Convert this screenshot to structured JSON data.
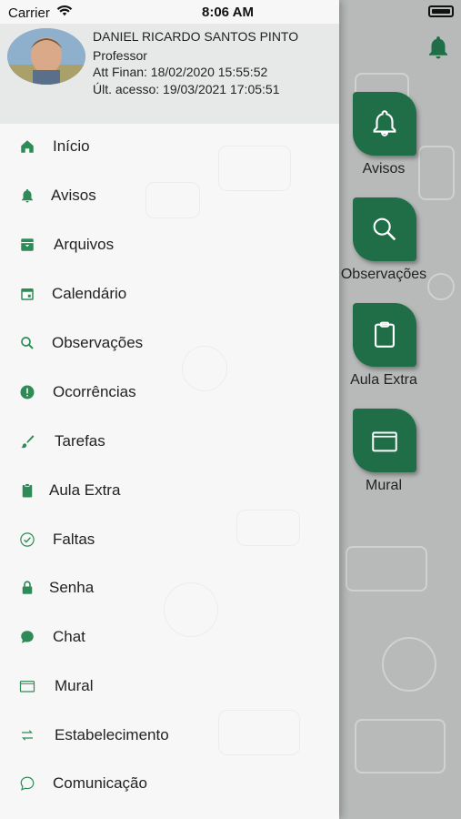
{
  "status": {
    "carrier": "Carrier",
    "time": "8:06 AM"
  },
  "user": {
    "name": "DANIEL RICARDO SANTOS PINTO",
    "role": "Professor",
    "att_finan": "Att Finan: 18/02/2020 15:55:52",
    "last_access": "Últ. acesso: 19/03/2021 17:05:51"
  },
  "menu": [
    {
      "label": "Início",
      "icon": "home-icon"
    },
    {
      "label": "Avisos",
      "icon": "bell-icon"
    },
    {
      "label": "Arquivos",
      "icon": "archive-icon"
    },
    {
      "label": "Calendário",
      "icon": "calendar-icon"
    },
    {
      "label": "Observações",
      "icon": "search-icon"
    },
    {
      "label": "Ocorrências",
      "icon": "alert-icon"
    },
    {
      "label": "Tarefas",
      "icon": "brush-icon"
    },
    {
      "label": "Aula Extra",
      "icon": "clipboard-icon"
    },
    {
      "label": "Faltas",
      "icon": "check-circle-icon"
    },
    {
      "label": "Senha",
      "icon": "lock-icon"
    },
    {
      "label": "Chat",
      "icon": "chat-icon"
    },
    {
      "label": "Mural",
      "icon": "board-icon"
    },
    {
      "label": "Estabelecimento",
      "icon": "swap-icon"
    },
    {
      "label": "Comunicação",
      "icon": "speech-icon"
    }
  ],
  "tiles": [
    {
      "label": "Avisos",
      "icon": "bell-icon"
    },
    {
      "label": "Observações",
      "icon": "search-icon"
    },
    {
      "label": "Aula Extra",
      "icon": "clipboard-icon"
    },
    {
      "label": "Mural",
      "icon": "board-icon"
    }
  ],
  "colors": {
    "accent": "#1f6e48",
    "icon_green": "#2e8b57"
  }
}
